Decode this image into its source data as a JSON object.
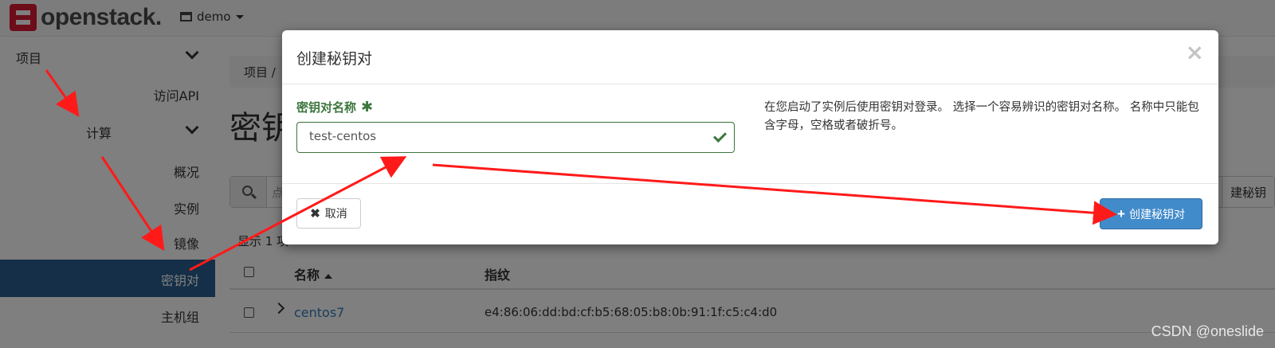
{
  "app": {
    "logo_text": "openstack."
  },
  "topbar": {
    "project": "demo"
  },
  "sidebar": {
    "items": [
      {
        "label": "项目"
      },
      {
        "label": "访问API"
      },
      {
        "label": "计算"
      },
      {
        "label": "概况"
      },
      {
        "label": "实例"
      },
      {
        "label": "镜像"
      },
      {
        "label": "密钥对"
      },
      {
        "label": "主机组"
      }
    ],
    "active": "密钥对"
  },
  "main": {
    "breadcrumb": "项目 /",
    "title": "密钥",
    "search_placeholder": "点",
    "create_button_partial": "建秘钥",
    "count_text": "显示 1 项",
    "table": {
      "headers": [
        "名称",
        "指纹"
      ],
      "rows": [
        {
          "name": "centos7",
          "fingerprint": "e4:86:06:dd:bd:cf:b5:68:05:b8:0b:91:1f:c5:c4:d0"
        }
      ]
    }
  },
  "modal": {
    "title": "创建秘钥对",
    "close_glyph": "×",
    "field_label": "密钥对名称",
    "required_mark": "✱",
    "field_value": "test-centos",
    "help_text": "在您启动了实例后使用密钥对登录。 选择一个容易辨识的密钥对名称。 名称中只能包含字母，空格或者破折号。",
    "cancel_label": "取消",
    "submit_label": "创建秘钥对"
  },
  "watermark": "CSDN @oneslide",
  "colors": {
    "primary": "#428bca",
    "success": "#3c763d",
    "sidebar_active": "#285e8e",
    "annotation": "#ff1a1a"
  }
}
